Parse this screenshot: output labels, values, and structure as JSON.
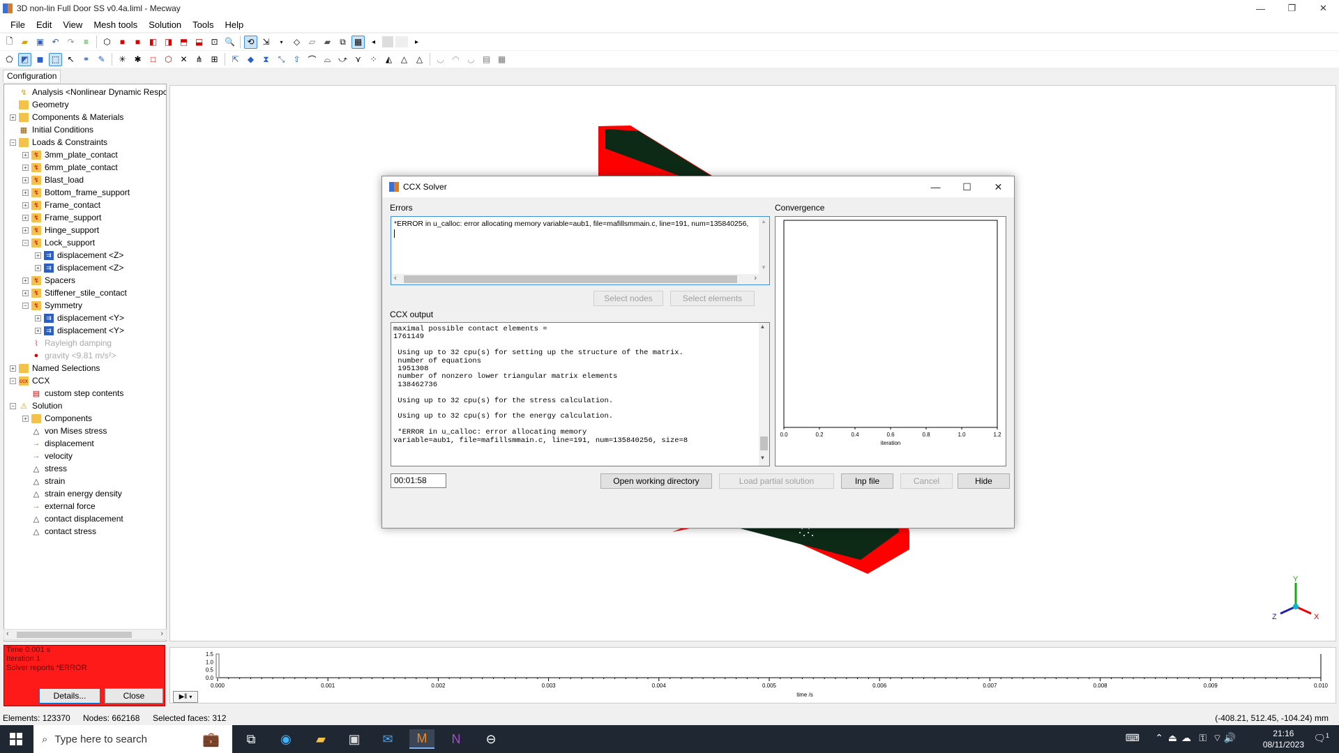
{
  "window": {
    "title": "3D non-lin Full Door SS v0.4a.liml - Mecway",
    "minimize": "—",
    "maximize": "❐",
    "close": "✕"
  },
  "menu": [
    "File",
    "Edit",
    "View",
    "Mesh tools",
    "Solution",
    "Tools",
    "Help"
  ],
  "left_tab": "Configuration",
  "tree": [
    {
      "label": "Analysis <Nonlinear Dynamic Respc",
      "level": 0,
      "exp": "",
      "icon": "analysis"
    },
    {
      "label": "Geometry",
      "level": 0,
      "exp": "",
      "icon": "folder"
    },
    {
      "label": "Components & Materials",
      "level": 0,
      "exp": "+",
      "icon": "folder"
    },
    {
      "label": "Initial Conditions",
      "level": 0,
      "exp": "",
      "icon": "init"
    },
    {
      "label": "Loads & Constraints",
      "level": 0,
      "exp": "-",
      "icon": "folder"
    },
    {
      "label": "3mm_plate_contact",
      "level": 1,
      "exp": "+",
      "icon": "folder-y"
    },
    {
      "label": "6mm_plate_contact",
      "level": 1,
      "exp": "+",
      "icon": "folder-y"
    },
    {
      "label": "Blast_load",
      "level": 1,
      "exp": "+",
      "icon": "folder-y"
    },
    {
      "label": "Bottom_frame_support",
      "level": 1,
      "exp": "+",
      "icon": "folder-y"
    },
    {
      "label": "Frame_contact",
      "level": 1,
      "exp": "+",
      "icon": "folder-y"
    },
    {
      "label": "Frame_support",
      "level": 1,
      "exp": "+",
      "icon": "folder-y"
    },
    {
      "label": "Hinge_support",
      "level": 1,
      "exp": "+",
      "icon": "folder-y"
    },
    {
      "label": "Lock_support",
      "level": 1,
      "exp": "-",
      "icon": "folder-y"
    },
    {
      "label": "displacement <Z>",
      "level": 2,
      "exp": "+",
      "icon": "disp"
    },
    {
      "label": "displacement <Z>",
      "level": 2,
      "exp": "+",
      "icon": "disp"
    },
    {
      "label": "Spacers",
      "level": 1,
      "exp": "+",
      "icon": "folder-y"
    },
    {
      "label": "Stiffener_stile_contact",
      "level": 1,
      "exp": "+",
      "icon": "folder-y"
    },
    {
      "label": "Symmetry",
      "level": 1,
      "exp": "-",
      "icon": "folder-y"
    },
    {
      "label": "displacement <Y>",
      "level": 2,
      "exp": "+",
      "icon": "disp"
    },
    {
      "label": "displacement <Y>",
      "level": 2,
      "exp": "+",
      "icon": "disp"
    },
    {
      "label": "Rayleigh damping",
      "level": 1,
      "exp": "",
      "icon": "damp",
      "gray": true
    },
    {
      "label": "gravity <9.81 m/s²>",
      "level": 1,
      "exp": "",
      "icon": "grav",
      "gray": true
    },
    {
      "label": "Named Selections",
      "level": 0,
      "exp": "+",
      "icon": "folder"
    },
    {
      "label": "CCX",
      "level": 0,
      "exp": "-",
      "icon": "ccx"
    },
    {
      "label": "custom step contents",
      "level": 1,
      "exp": "",
      "icon": "ccxdoc"
    },
    {
      "label": "Solution",
      "level": 0,
      "exp": "-",
      "icon": "sol"
    },
    {
      "label": "Components",
      "level": 1,
      "exp": "+",
      "icon": "folder"
    },
    {
      "label": "von Mises stress",
      "level": 1,
      "exp": "",
      "icon": "tri"
    },
    {
      "label": "displacement",
      "level": 1,
      "exp": "",
      "icon": "arrow"
    },
    {
      "label": "velocity",
      "level": 1,
      "exp": "",
      "icon": "arrow"
    },
    {
      "label": "stress",
      "level": 1,
      "exp": "",
      "icon": "tri"
    },
    {
      "label": "strain",
      "level": 1,
      "exp": "",
      "icon": "tri"
    },
    {
      "label": "strain energy density",
      "level": 1,
      "exp": "",
      "icon": "tri"
    },
    {
      "label": "external force",
      "level": 1,
      "exp": "",
      "icon": "arrow"
    },
    {
      "label": "contact displacement",
      "level": 1,
      "exp": "",
      "icon": "tri"
    },
    {
      "label": "contact stress",
      "level": 1,
      "exp": "",
      "icon": "tri"
    }
  ],
  "status_box": {
    "time": "Time 0.001 s",
    "iteration": "Iteration 1",
    "report": "Solver reports *ERROR",
    "details": "Details...",
    "close": "Close",
    "color": "#ff1a1a"
  },
  "dialog": {
    "title": "CCX Solver",
    "errors_label": "Errors",
    "errors_text": "*ERROR in u_calloc: error allocating memory variable=aub1, file=mafillsmmain.c, line=191, num=135840256,",
    "select_nodes": "Select nodes",
    "select_elements": "Select elements",
    "convergence_label": "Convergence",
    "output_label": "CCX output",
    "output_lines": [
      "maximal possible contact elements =",
      "1761149",
      "",
      " Using up to 32 cpu(s) for setting up the structure of the matrix.",
      " number of equations",
      " 1951308",
      " number of nonzero lower triangular matrix elements",
      " 138462736",
      "",
      " Using up to 32 cpu(s) for the stress calculation.",
      "",
      " Using up to 32 cpu(s) for the energy calculation.",
      "",
      " *ERROR in u_calloc: error allocating memory",
      "variable=aub1, file=mafillsmmain.c, line=191, num=135840256, size=8"
    ],
    "elapsed": "00:01:58",
    "open_dir": "Open working directory",
    "load_partial": "Load partial solution",
    "inp_file": "Inp file",
    "cancel": "Cancel",
    "hide": "Hide",
    "conv_x_ticks": [
      "0.0",
      "0.2",
      "0.4",
      "0.6",
      "0.8",
      "1.0",
      "1.2"
    ],
    "conv_xlabel": "iteration"
  },
  "timeline": {
    "y_ticks": [
      "1.5",
      "1.0",
      "0.5",
      "0.0"
    ],
    "x_ticks": [
      "0.000",
      "0.001",
      "0.002",
      "0.003",
      "0.004",
      "0.005",
      "0.006",
      "0.007",
      "0.008",
      "0.009",
      "0.010"
    ],
    "xlabel": "time /s"
  },
  "axes_triad": {
    "x": "X",
    "y": "Y",
    "z": "Z"
  },
  "statusbar": {
    "elements": "Elements: 123370",
    "nodes": "Nodes: 662168",
    "selected": "Selected faces: 312",
    "coords": "(-408.21, 512.45, -104.24) mm"
  },
  "taskbar": {
    "search_placeholder": "Type here to search",
    "time": "21:16",
    "date": "08/11/2023",
    "notification_count": "1"
  },
  "colors": {
    "model_red": "#ff0000",
    "model_dark": "#0d2a17",
    "status_red": "#ff1a1a",
    "accent": "#0078d7"
  }
}
